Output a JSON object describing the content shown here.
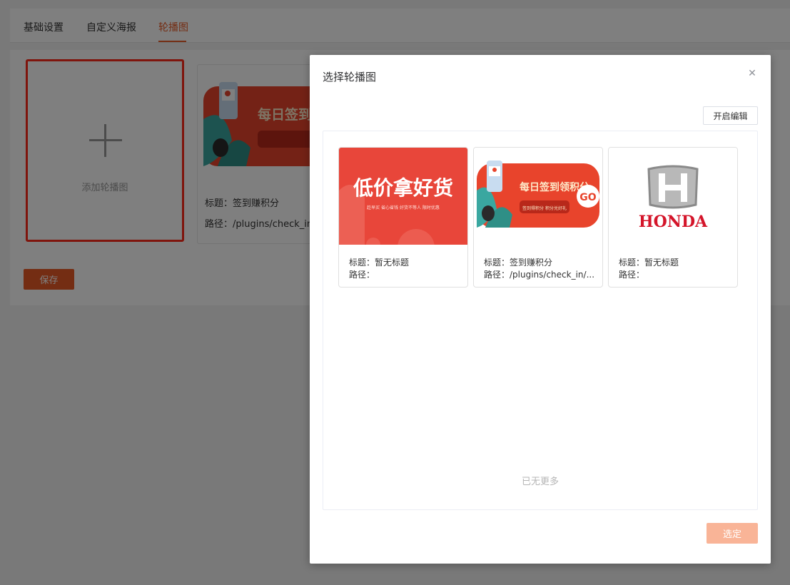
{
  "colors": {
    "accent": "#e85a26",
    "highlight_border": "#ff2a1a",
    "confirm_disabled": "#f9b497"
  },
  "tabs": [
    {
      "label": "基础设置"
    },
    {
      "label": "自定义海报"
    },
    {
      "label": "轮播图",
      "active": true
    }
  ],
  "page": {
    "add_label": "添加轮播图",
    "bg_card": {
      "banner_text": "每日签到领积分",
      "title_line": "标题：签到赚积分",
      "path_line": "路径：/plugins/check_in/in"
    },
    "save_label": "保存"
  },
  "dialog": {
    "title": "选择轮播图",
    "close_icon": "close-icon",
    "edit_label": "开启编辑",
    "items": [
      {
        "banner": "低价拿好货",
        "banner_sub": "趁早买 省心省钱 好货不等人 限时优惠",
        "title_line": "标题：暂无标题",
        "path_line": "路径："
      },
      {
        "banner": "每日签到领积分",
        "banner_sub": "签到得积分 积分兑好礼",
        "title_line": "标题：签到赚积分",
        "path_line": "路径：/plugins/check_in/..."
      },
      {
        "banner": "HONDA",
        "title_line": "标题：暂无标题",
        "path_line": "路径："
      }
    ],
    "no_more": "已无更多",
    "confirm_label": "选定"
  }
}
